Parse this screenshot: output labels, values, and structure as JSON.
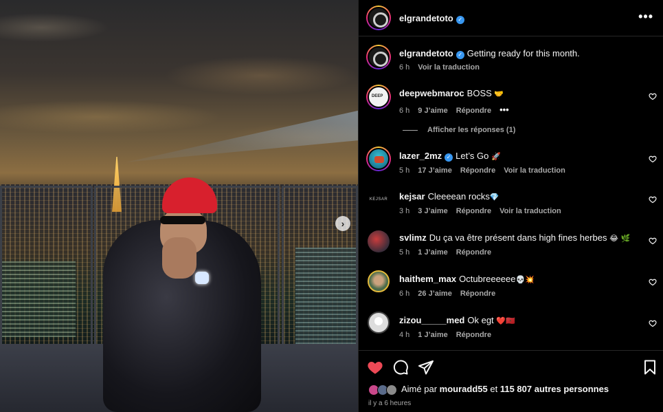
{
  "post": {
    "author": "elgrandetoto",
    "more_icon": "•••",
    "carousel_next": "›",
    "caption": {
      "username": "elgrandetoto",
      "text": "Getting ready for this month.",
      "time": "6 h",
      "translate": "Voir la traduction"
    }
  },
  "comments": [
    {
      "username": "deepwebmaroc",
      "verified": false,
      "text": "BOSS",
      "emoji": "🤝",
      "time": "6 h",
      "likes": "9 J’aime",
      "reply": "Répondre",
      "extra": "•••",
      "translate": ""
    },
    {
      "username": "lazer_2mz",
      "verified": true,
      "text": "Let’s Go",
      "emoji": "🚀",
      "time": "5 h",
      "likes": "17 J’aime",
      "reply": "Répondre",
      "translate": "Voir la traduction"
    },
    {
      "username": "kejsar",
      "verified": false,
      "avatar_text": "KEJSAR",
      "text": "Cleeeean rocks",
      "emoji": "💎",
      "time": "3 h",
      "likes": "3 J’aime",
      "reply": "Répondre",
      "translate": "Voir la traduction"
    },
    {
      "username": "svlimz",
      "verified": false,
      "text": "Du ça va être présent dans high fines herbes",
      "emoji": "😂 🌿",
      "time": "5 h",
      "likes": "1 J’aime",
      "reply": "Répondre",
      "translate": ""
    },
    {
      "username": "haithem_max",
      "verified": false,
      "text": "Octubreeeeee",
      "emoji": "💀💥",
      "time": "6 h",
      "likes": "26 J’aime",
      "reply": "Répondre",
      "translate": ""
    },
    {
      "username": "zizou_____med",
      "verified": false,
      "text": "Ok egt",
      "emoji": "❤️🇲🇦",
      "time": "4 h",
      "likes": "1 J’aime",
      "reply": "Répondre",
      "translate": ""
    }
  ],
  "show_replies": "Afficher les réponses (1)",
  "likes": {
    "prefix": "Aimé par",
    "user": "mouradd55",
    "middle": "et",
    "count": "115 807 autres personnes",
    "time": "il y a 6 heures"
  },
  "colors": {
    "liked_heart": "#ed4956",
    "verified": "#3897f0",
    "muted": "#a8a8a8"
  }
}
